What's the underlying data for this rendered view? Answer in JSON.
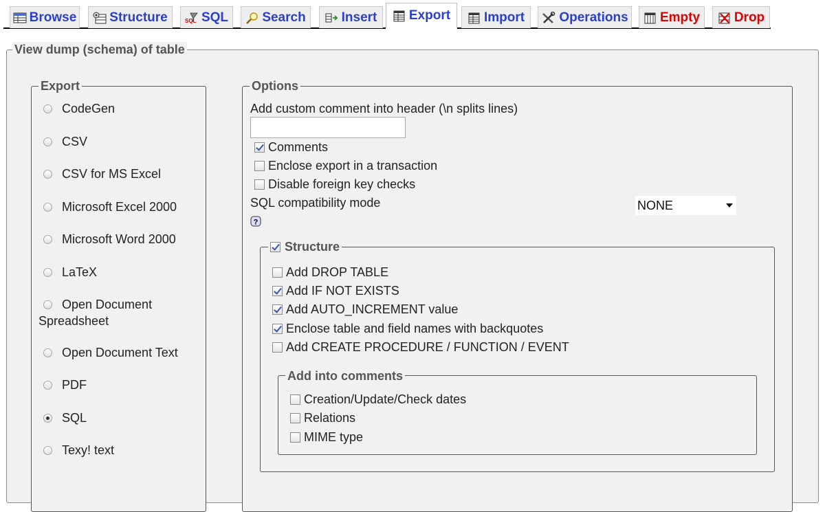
{
  "tabs": [
    {
      "id": "browse",
      "label": "Browse",
      "icon": "table-icon"
    },
    {
      "id": "structure",
      "label": "Structure",
      "icon": "structure-icon"
    },
    {
      "id": "sql",
      "label": "SQL",
      "icon": "sql-icon"
    },
    {
      "id": "search",
      "label": "Search",
      "icon": "magnifier-icon"
    },
    {
      "id": "insert",
      "label": "Insert",
      "icon": "insert-row-icon"
    },
    {
      "id": "export",
      "label": "Export",
      "icon": "export-icon",
      "active": true
    },
    {
      "id": "import",
      "label": "Import",
      "icon": "import-icon"
    },
    {
      "id": "operations",
      "label": "Operations",
      "icon": "tools-icon"
    },
    {
      "id": "empty",
      "label": "Empty",
      "icon": "empty-table-icon"
    },
    {
      "id": "drop",
      "label": "Drop",
      "icon": "drop-icon"
    }
  ],
  "page": {
    "legend": "View dump (schema) of table"
  },
  "export": {
    "legend": "Export",
    "formats": [
      {
        "label": "CodeGen",
        "checked": false
      },
      {
        "label": "CSV",
        "checked": false
      },
      {
        "label": "CSV for MS Excel",
        "checked": false
      },
      {
        "label": "Microsoft Excel 2000",
        "checked": false
      },
      {
        "label": "Microsoft Word 2000",
        "checked": false
      },
      {
        "label": "LaTeX",
        "checked": false
      },
      {
        "label": "Open Document",
        "label2": "Spreadsheet",
        "checked": false
      },
      {
        "label": "Open Document Text",
        "checked": false
      },
      {
        "label": "PDF",
        "checked": false
      },
      {
        "label": "SQL",
        "checked": true
      },
      {
        "label": "Texy! text",
        "checked": false
      }
    ]
  },
  "options": {
    "legend": "Options",
    "custom_comment_label": "Add custom comment into header (\\n splits lines)",
    "custom_comment_value": "",
    "comments_label": "Comments",
    "comments_checked": true,
    "transaction_label": "Enclose export in a transaction",
    "transaction_checked": false,
    "fk_label": "Disable foreign key checks",
    "fk_checked": false,
    "compat_label": "SQL compatibility mode",
    "compat_value": "NONE",
    "structure": {
      "legend": "Structure",
      "checked": true,
      "items": [
        {
          "label": "Add DROP TABLE",
          "checked": false
        },
        {
          "label": "Add IF NOT EXISTS",
          "checked": true
        },
        {
          "label": "Add AUTO_INCREMENT value",
          "checked": true
        },
        {
          "label": "Enclose table and field names with backquotes",
          "checked": true
        },
        {
          "label": "Add CREATE PROCEDURE / FUNCTION / EVENT",
          "checked": false
        }
      ],
      "add_into_comments": {
        "legend": "Add into comments",
        "items": [
          {
            "label": "Creation/Update/Check dates",
            "checked": false
          },
          {
            "label": "Relations",
            "checked": false
          },
          {
            "label": "MIME type",
            "checked": false
          }
        ]
      }
    }
  },
  "colors": {
    "tab_text": "#2b3fcc",
    "tab_danger": "#e00000",
    "panel_bg": "#f1f1f1",
    "legend_text": "#555555"
  }
}
